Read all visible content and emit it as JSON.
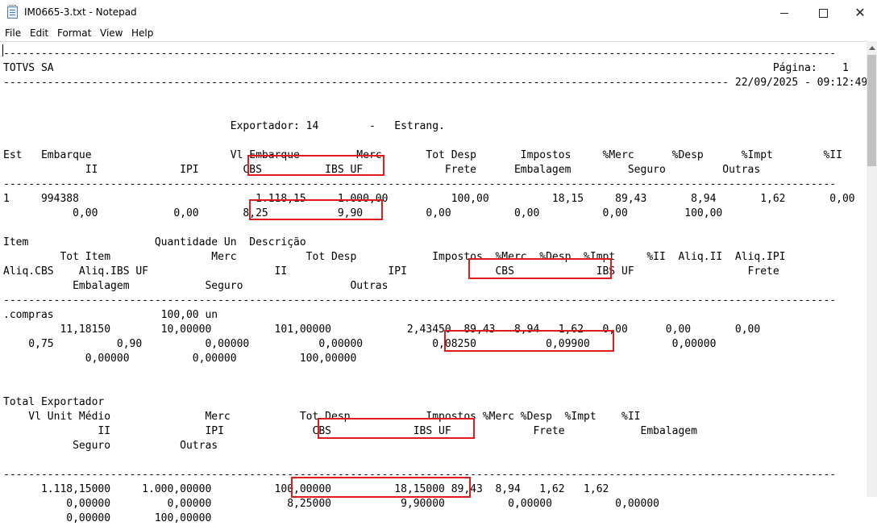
{
  "window": {
    "title": "IM0665-3.txt - Notepad",
    "minimize_icon": "minimize-icon",
    "maximize_icon": "maximize-icon",
    "close_icon": "close-icon",
    "close_glyph": "✕"
  },
  "menu": [
    "File",
    "Edit",
    "Format",
    "View",
    "Help"
  ],
  "document": {
    "lines": [
      "------------------------------------------------------------------------------------------------------------------------------------",
      "TOTVS SA                                                                                                                  Página:    1",
      "------------------------------------------------------------------------------------------------------------------- 22/09/2025 - 09:12:49",
      "",
      "",
      "                                    Exportador: 14        -   Estrang.",
      "",
      "Est   Embarque                      Vl Embarque         Merc       Tot Desp       Impostos     %Merc      %Desp      %Impt        %II",
      "             II             IPI       CBS          IBS UF             Frete      Embalagem         Seguro         Outras",
      "------------------------------------------------------------------------------------------------------------------------------------",
      "1     994388                            1.118,15     1.000,00          100,00          18,15     89,43       8,94       1,62       0,00",
      "           0,00            0,00       8,25           9,90          0,00          0,00          0,00         100,00",
      "",
      "Item                    Quantidade Un  Descrição",
      "         Tot Item                Merc           Tot Desp            Impostos  %Merc  %Desp  %Impt     %II  Aliq.II  Aliq.IPI",
      "Aliq.CBS    Aliq.IBS UF                    II                IPI              CBS             IBS UF                  Frete",
      "           Embalagem            Seguro                 Outras",
      "------------------------------------------------------------------------------------------------------------------------------------",
      ".compras                 100,00 un",
      "         11,18150        10,00000          101,00000            2,43450  89,43   8,94   1,62   0,00      0,00       0,00",
      "    0,75          0,90          0,00000           0,00000           0,08250           0,09900             0,00000",
      "             0,00000          0,00000          100,00000",
      "",
      "",
      "Total Exportador",
      "    Vl Unit Médio               Merc           Tot Desp            Impostos %Merc %Desp  %Impt    %II",
      "               II               IPI              CBS             IBS UF             Frete            Embalagem",
      "           Seguro           Outras",
      "",
      "------------------------------------------------------------------------------------------------------------------------------------",
      "      1.118,15000     1.000,00000          100,00000          18,15000 89,43  8,94   1,62   1,62",
      "          0,00000         0,00000            8,25000           9,90000          0,00000          0,00000",
      "          0,00000       100,00000"
    ]
  },
  "colors": {
    "highlight_box": "#e01b1b",
    "scroll_thumb": "#c1c1c1"
  }
}
